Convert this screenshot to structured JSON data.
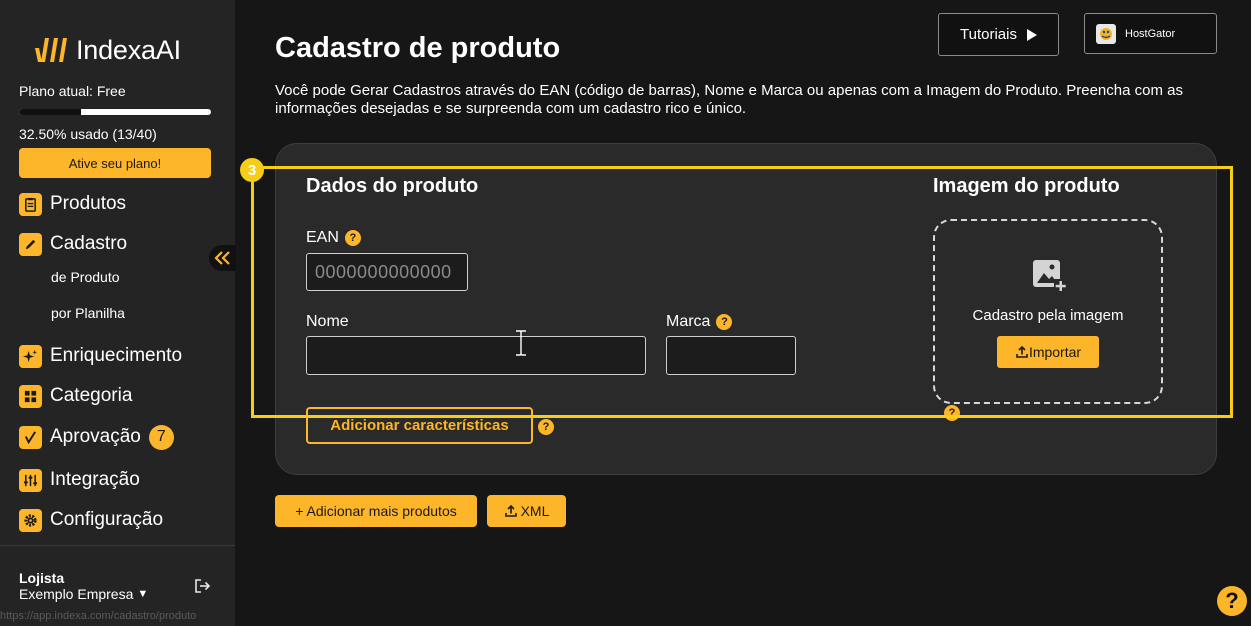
{
  "sidebar": {
    "logo": "IndexaAI",
    "plan_label": "Plano atual: Free",
    "usage_fraction": 0.325,
    "usage_text": "32.50% usado (13/40)",
    "plan_button": "Ative seu plano!",
    "items": [
      {
        "label": "Produtos",
        "icon": "clipboard-icon"
      },
      {
        "label": "Cadastro",
        "icon": "pencil-icon"
      },
      {
        "label": "Enriquecimento",
        "icon": "sparkle-icon"
      },
      {
        "label": "Categoria",
        "icon": "grid-icon"
      },
      {
        "label": "Aprovação",
        "icon": "check-icon",
        "badge": "7"
      },
      {
        "label": "Integração",
        "icon": "sliders-icon"
      },
      {
        "label": "Configuração",
        "icon": "gear-icon"
      }
    ],
    "sub_items": [
      "de Produto",
      "por Planilha"
    ],
    "user_role": "Lojista",
    "company": "Exemplo Empresa",
    "status_url": "https://app.indexa.com/cadastro/produto"
  },
  "header": {
    "title": "Cadastro de produto",
    "description": "Você pode Gerar Cadastros através do EAN (código de barras), Nome e Marca ou apenas com a Imagem do Produto. Preencha com as informações desejadas e se surpreenda com um cadastro rico e único.",
    "tutorials_button": "Tutoriais",
    "hosting_button": "HostGator"
  },
  "form": {
    "section_title": "Dados do produto",
    "ean_label": "EAN",
    "ean_placeholder": "0000000000000",
    "name_label": "Nome",
    "name_value": "",
    "brand_label": "Marca",
    "brand_value": "",
    "add_features_button": "Adicionar características"
  },
  "image": {
    "section_title": "Imagem do produto",
    "drop_text": "Cadastro pela imagem",
    "import_button": "Importar"
  },
  "actions": {
    "add_more_button": "+ Adicionar mais produtos",
    "xml_button": "XML"
  },
  "tour": {
    "step": "3"
  },
  "colors": {
    "accent": "#FDB52A",
    "highlight": "#F6CD17",
    "background": "#161616",
    "sidebar": "#242424",
    "card": "#2a2a2a"
  }
}
